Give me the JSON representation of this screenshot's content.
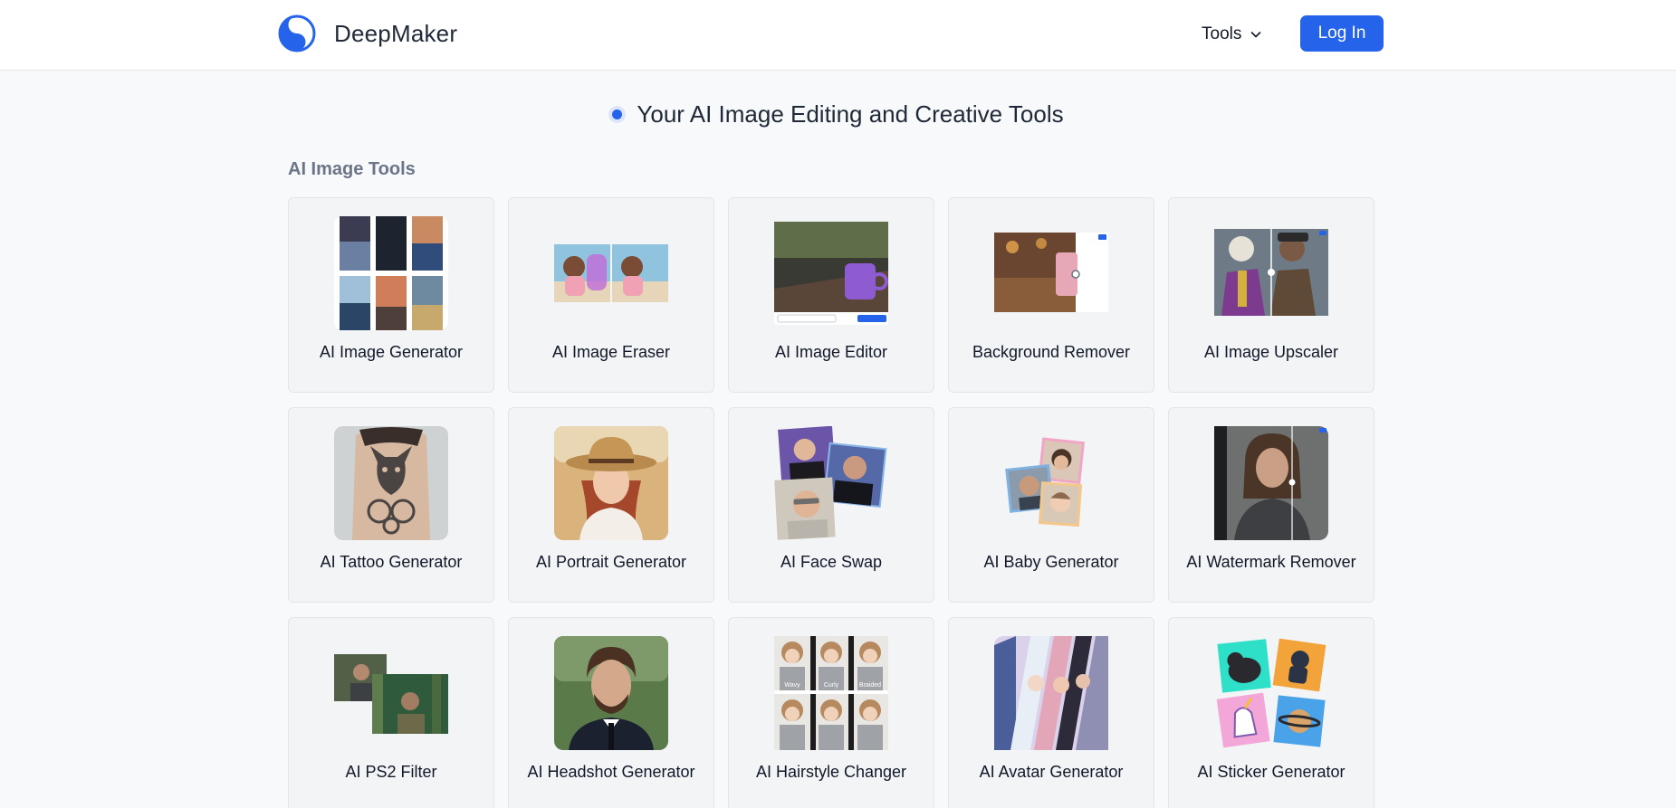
{
  "header": {
    "brand": "DeepMaker",
    "logo_icon": "yin-yang-logo-icon",
    "tools_label": "Tools",
    "login_label": "Log In",
    "accent_color": "#2563eb"
  },
  "hero": {
    "text": "Your AI Image Editing and Creative Tools"
  },
  "section": {
    "title": "AI Image Tools",
    "tools": [
      {
        "label": "AI Image Generator"
      },
      {
        "label": "AI Image Eraser"
      },
      {
        "label": "AI Image Editor"
      },
      {
        "label": "Background Remover"
      },
      {
        "label": "AI Image Upscaler"
      },
      {
        "label": "AI Tattoo Generator"
      },
      {
        "label": "AI Portrait Generator"
      },
      {
        "label": "AI Face Swap"
      },
      {
        "label": "AI Baby Generator"
      },
      {
        "label": "AI Watermark Remover"
      },
      {
        "label": "AI PS2 Filter"
      },
      {
        "label": "AI Headshot Generator"
      },
      {
        "label": "AI Hairstyle Changer"
      },
      {
        "label": "AI Avatar Generator"
      },
      {
        "label": "AI Sticker Generator"
      }
    ]
  },
  "hairstyle_tags": [
    "Wavy",
    "Curly",
    "Braided"
  ]
}
